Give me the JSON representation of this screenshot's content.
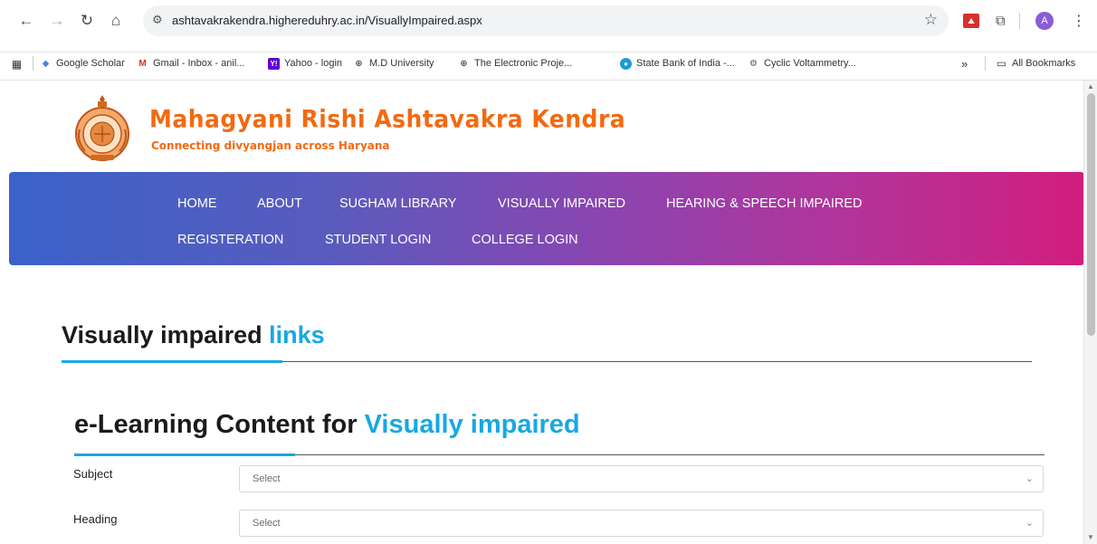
{
  "browser": {
    "url": "ashtavakrakendra.highereduhry.ac.in/VisuallyImpaired.aspx",
    "profile_initial": "A",
    "bookmarks": [
      {
        "label": "Google Scholar"
      },
      {
        "label": "Gmail - Inbox - anil..."
      },
      {
        "label": "Yahoo - login"
      },
      {
        "label": "M.D University"
      },
      {
        "label": "The Electronic Proje..."
      },
      {
        "label": "State Bank of India -..."
      },
      {
        "label": "Cyclic Voltammetry..."
      }
    ],
    "overflow_label": "»",
    "all_bookmarks_label": "All Bookmarks"
  },
  "site": {
    "title": "Mahagyani Rishi Ashtavakra Kendra",
    "tagline": "Connecting divyangjan across Haryana"
  },
  "nav": {
    "row1": [
      "HOME",
      "ABOUT",
      "SUGHAM LIBRARY",
      "VISUALLY IMPAIRED",
      "HEARING & SPEECH IMPAIRED"
    ],
    "row2": [
      "REGISTERATION",
      "STUDENT LOGIN",
      "COLLEGE LOGIN"
    ]
  },
  "section1": {
    "heading_main": "Visually impaired",
    "heading_accent": "links"
  },
  "section2": {
    "heading_main": "e-Learning Content for",
    "heading_accent": "Visually impaired"
  },
  "form": {
    "subject": {
      "label": "Subject",
      "value": "Select"
    },
    "heading": {
      "label": "Heading",
      "value": "Select"
    }
  },
  "colors": {
    "accent": "#17a8e3",
    "brand_orange": "#f36a10"
  }
}
